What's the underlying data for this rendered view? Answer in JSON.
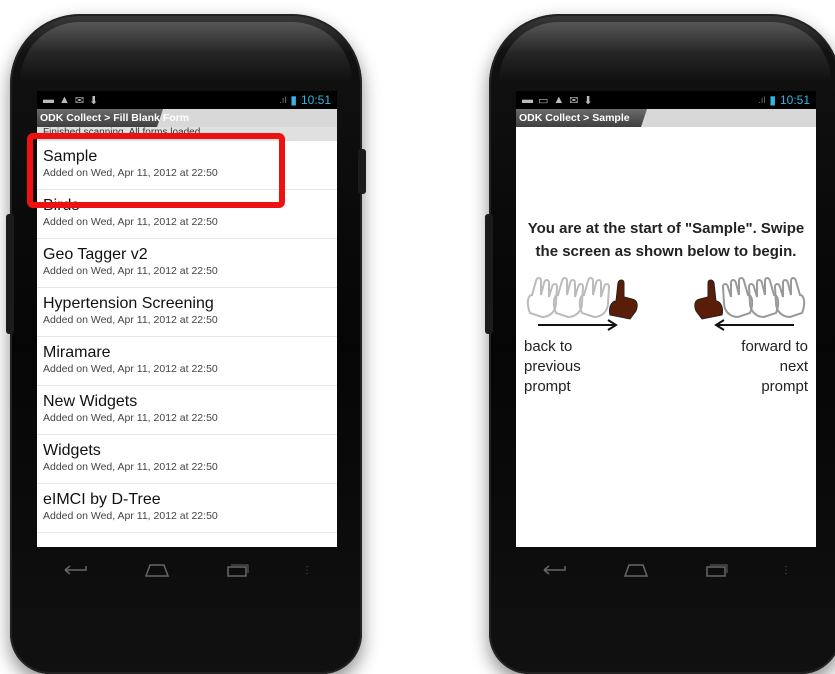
{
  "status_bar": {
    "time": "10:51"
  },
  "left": {
    "title": "ODK Collect > Fill Blank Form",
    "message": "Finished scanning. All forms loaded.",
    "forms": [
      {
        "name": "Sample",
        "date": "Added on Wed, Apr 11, 2012 at 22:50"
      },
      {
        "name": "Birds",
        "date": "Added on Wed, Apr 11, 2012 at 22:50"
      },
      {
        "name": "Geo Tagger v2",
        "date": "Added on Wed, Apr 11, 2012 at 22:50"
      },
      {
        "name": "Hypertension Screening",
        "date": "Added on Wed, Apr 11, 2012 at 22:50"
      },
      {
        "name": "Miramare",
        "date": "Added on Wed, Apr 11, 2012 at 22:50"
      },
      {
        "name": "New Widgets",
        "date": "Added on Wed, Apr 11, 2012 at 22:50"
      },
      {
        "name": "Widgets",
        "date": "Added on Wed, Apr 11, 2012 at 22:50"
      },
      {
        "name": "eIMCI by D-Tree",
        "date": "Added on Wed, Apr 11, 2012 at 22:50"
      }
    ]
  },
  "right": {
    "title": "ODK Collect > Sample",
    "instructions": "You are at the start of \"Sample\". Swipe the screen as shown below to begin.",
    "back_label_1": "back to",
    "back_label_2": "previous",
    "back_label_3": "prompt",
    "forward_label_1": "forward to",
    "forward_label_2": "next",
    "forward_label_3": "prompt"
  },
  "colors": {
    "highlight": "#ee1111",
    "status_accent": "#33b5e5",
    "hand": "#5a1d08"
  },
  "icons": [
    "back-nav-icon",
    "home-nav-icon",
    "recent-apps-icon",
    "menu-dots-icon",
    "swipe-hand-icon"
  ]
}
